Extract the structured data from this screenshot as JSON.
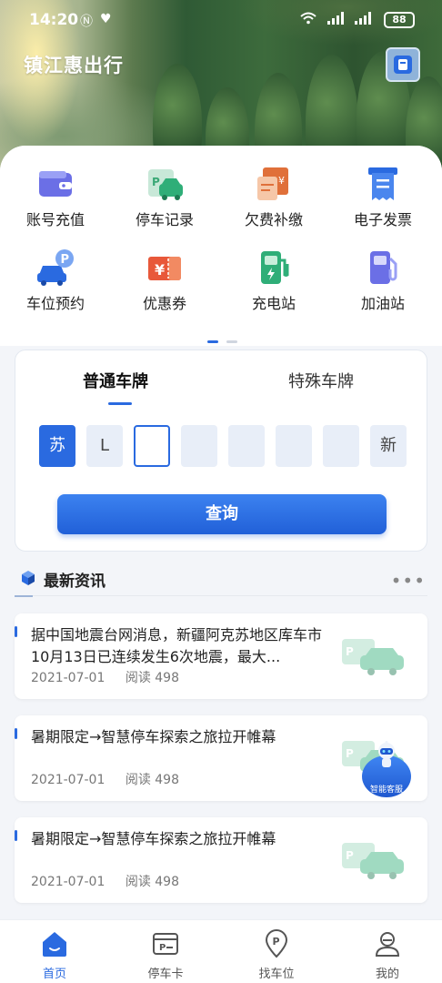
{
  "status_bar": {
    "time": "14:20",
    "battery": "88"
  },
  "header": {
    "app_title": "镇江惠出行"
  },
  "menu": {
    "items": [
      {
        "label": "账号充值",
        "icon": "wallet-icon"
      },
      {
        "label": "停车记录",
        "icon": "parking-record-icon"
      },
      {
        "label": "欠费补缴",
        "icon": "arrears-payment-icon"
      },
      {
        "label": "电子发票",
        "icon": "e-invoice-icon"
      },
      {
        "label": "车位预约",
        "icon": "space-reservation-icon"
      },
      {
        "label": "优惠券",
        "icon": "coupon-icon"
      },
      {
        "label": "充电站",
        "icon": "charging-station-icon"
      },
      {
        "label": "加油站",
        "icon": "gas-station-icon"
      }
    ]
  },
  "plate": {
    "tabs": [
      "普通车牌",
      "特殊车牌"
    ],
    "province": "苏",
    "letter": "L",
    "new_energy": "新",
    "query_label": "查询"
  },
  "news": {
    "title": "最新资讯",
    "items": [
      {
        "text": "据中国地震台网消息，新疆阿克苏地区库车市10月13日已连续发生6次地震，最大...",
        "date": "2021-07-01",
        "reads": "阅读 498"
      },
      {
        "text": "暑期限定→智慧停车探索之旅拉开帷幕",
        "date": "2021-07-01",
        "reads": "阅读 498"
      },
      {
        "text": "暑期限定→智慧停车探索之旅拉开帷幕",
        "date": "2021-07-01",
        "reads": "阅读 498"
      }
    ]
  },
  "customer_service": {
    "label": "智能客服"
  },
  "bottom_nav": {
    "items": [
      {
        "label": "首页",
        "icon": "home-icon"
      },
      {
        "label": "停车卡",
        "icon": "parking-card-icon"
      },
      {
        "label": "找车位",
        "icon": "location-pin-icon"
      },
      {
        "label": "我的",
        "icon": "user-icon"
      }
    ]
  },
  "colors": {
    "primary": "#2a6ae0",
    "background": "#f3f5f9"
  }
}
